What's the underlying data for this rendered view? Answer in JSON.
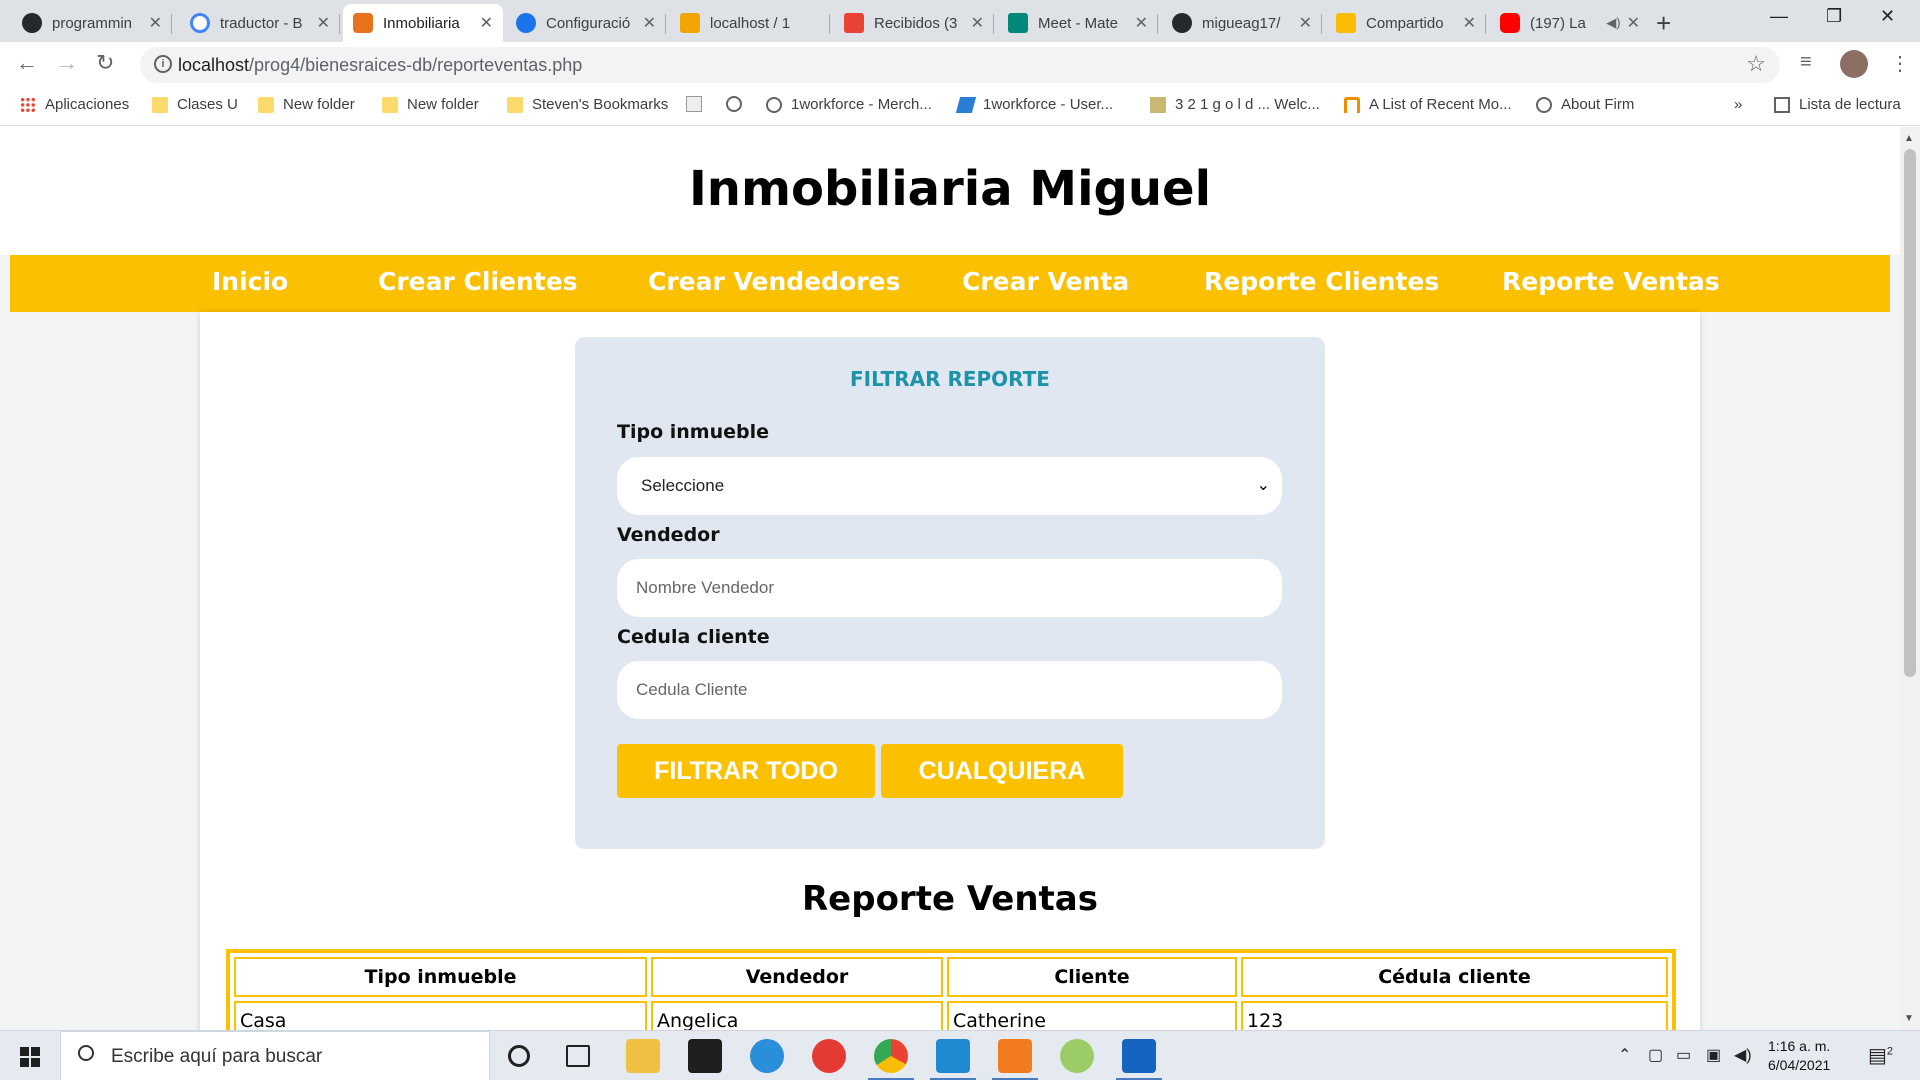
{
  "browser": {
    "tabs": [
      {
        "title": "programmin",
        "favicon_color": "#24292e"
      },
      {
        "title": "traductor - B",
        "favicon_color": "#4285f4"
      },
      {
        "title": "Inmobiliaria",
        "favicon_color": "#e8731c",
        "active": true
      },
      {
        "title": "Configuració",
        "favicon_color": "#1a73e8"
      },
      {
        "title": "localhost / 1",
        "favicon_color": "#f0a500"
      },
      {
        "title": "Recibidos (3",
        "favicon_color": "#ea4335"
      },
      {
        "title": "Meet - Mate",
        "favicon_color": "#00897b"
      },
      {
        "title": "migueag17/",
        "favicon_color": "#24292e"
      },
      {
        "title": "Compartido",
        "favicon_color": "#fbbc04"
      },
      {
        "title": "(197) La",
        "favicon_color": "#ff0000"
      }
    ],
    "close_glyph": "✕",
    "address": {
      "host": "localhost",
      "path": "/prog4/bienesraices-db/reporteventas.php"
    },
    "bookmarks": [
      {
        "label": "Aplicaciones",
        "icon": "apps-icon"
      },
      {
        "label": "Clases U",
        "icon": "folder-icon"
      },
      {
        "label": "New folder",
        "icon": "folder-icon"
      },
      {
        "label": "New folder",
        "icon": "folder-icon"
      },
      {
        "label": "Steven's Bookmarks",
        "icon": "folder-icon"
      },
      {
        "label": "",
        "icon": "page-icon"
      },
      {
        "label": "",
        "icon": "globe-icon"
      },
      {
        "label": "1workforce - Merch...",
        "icon": "globe-icon"
      },
      {
        "label": "1workforce - User...",
        "icon": "workforce-icon"
      },
      {
        "label": "3 2 1 g o l d ... Welc...",
        "icon": "321-icon"
      },
      {
        "label": "A List of Recent Mo...",
        "icon": "arch-icon"
      },
      {
        "label": "About Firm",
        "icon": "globe-icon"
      }
    ],
    "bookmarks_more": "»",
    "reading_list": "Lista de lectura"
  },
  "site": {
    "title": "Inmobiliaria Miguel",
    "nav": [
      "Inicio",
      "Crear Clientes",
      "Crear Vendedores",
      "Crear Venta",
      "Reporte Clientes",
      "Reporte Ventas"
    ],
    "accent_color": "#fbc100"
  },
  "filter": {
    "heading": "FILTRAR REPORTE",
    "tipo_label": "Tipo inmueble",
    "tipo_selected": "Seleccione",
    "vendedor_label": "Vendedor",
    "vendedor_placeholder": "Nombre Vendedor",
    "cedula_label": "Cedula cliente",
    "cedula_placeholder": "Cedula Cliente",
    "btn_all": "FILTRAR TODO",
    "btn_any": "CUALQUIERA"
  },
  "report": {
    "title": "Reporte Ventas",
    "columns": [
      "Tipo inmueble",
      "Vendedor",
      "Cliente",
      "Cédula cliente"
    ],
    "rows": [
      [
        "Casa",
        "Angelica",
        "Catherine",
        "123"
      ]
    ]
  },
  "taskbar": {
    "search_placeholder": "Escribe aquí para buscar",
    "time": "1:16 a. m.",
    "date": "6/04/2021",
    "notifications": "2"
  }
}
